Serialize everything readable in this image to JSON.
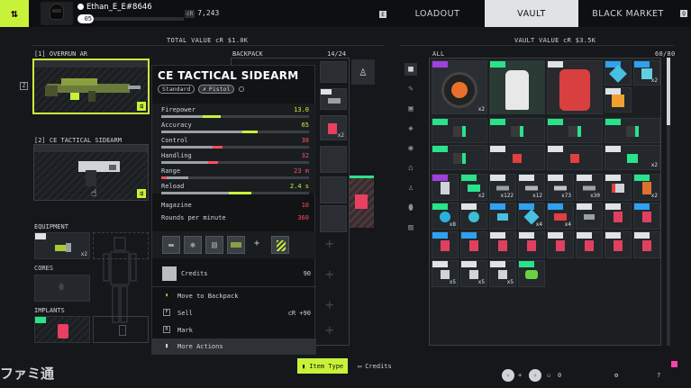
{
  "header": {
    "player_name": "Ethan_E_E#8646",
    "level": "05",
    "credits": "7,243",
    "cr_tag": "cR",
    "key_hint_e": "E",
    "tabs": [
      "LOADOUT",
      "VAULT",
      "BLACK MARKET"
    ],
    "active_tab": "VAULT",
    "key_hint_q": "Q"
  },
  "loadout": {
    "total_value": "TOTAL VALUE cR $1.0K",
    "slot1_label": "[1] OVERRUN AR",
    "slot2_label": "[2] CE TACTICAL SIDEARM",
    "equipment_label": "EQUIPMENT",
    "equipment_qty": "x2",
    "cores_label": "CORES",
    "implants_label": "IMPLANTS",
    "side_key": "Z"
  },
  "backpack": {
    "label": "BACKPACK",
    "count": "14/24",
    "qty_label": "x2"
  },
  "tooltip": {
    "title": "CE TACTICAL SIDEARM",
    "rarity": "Standard",
    "type": "Pistol",
    "stats": [
      {
        "name": "Firepower",
        "value": "13.0",
        "color": "#c8f23a",
        "base": 0.28,
        "mod": 0.12,
        "mod_color": "#c8f23a"
      },
      {
        "name": "Accuracy",
        "value": "65",
        "color": "#c8f23a",
        "base": 0.55,
        "mod": 0.1,
        "mod_color": "#c8f23a"
      },
      {
        "name": "Control",
        "value": "38",
        "color": "#ff4d5e",
        "base": 0.4,
        "mod": 0.07,
        "mod_color": "#ff4d5e"
      },
      {
        "name": "Handling",
        "value": "32",
        "color": "#ff4d5e",
        "base": 0.32,
        "mod": 0.07,
        "mod_color": "#ff4d5e"
      },
      {
        "name": "Range",
        "value": "23 m",
        "color": "#ff4d5e",
        "base": 0.18,
        "mod": 0.06,
        "mod_color": "#ff4d5e"
      },
      {
        "name": "Reload",
        "value": "2.4 s",
        "color": "#c8f23a",
        "base": 0.4,
        "mod": 0.15,
        "mod_color": "#c8f23a"
      }
    ],
    "magazine": {
      "name": "Magazine",
      "value": "10"
    },
    "rpm": {
      "name": "Rounds per minute",
      "value": "360"
    },
    "credits_label": "Credits",
    "credits_value": "90",
    "actions": [
      {
        "key": "▮",
        "label": "Move to Backpack",
        "right": ""
      },
      {
        "key": "F",
        "label": "Sell",
        "right": "cR +90"
      },
      {
        "key": "R",
        "label": "Mark",
        "right": ""
      }
    ],
    "more_actions": "More Actions"
  },
  "vault": {
    "total_value": "VAULT VALUE cR $3.5K",
    "filter_label": "ALL",
    "count": "60/80",
    "quantities": [
      "x2",
      "x2",
      "x2",
      "x2",
      "x122",
      "x12",
      "x73",
      "x30",
      "x2",
      "x8",
      "x4",
      "x4",
      "x5",
      "x5",
      "x5"
    ]
  },
  "bottom": {
    "item_type_btn": "Item Type",
    "credits_btn": "Credits",
    "friends_count": "0",
    "watermark": "ファミ通"
  }
}
